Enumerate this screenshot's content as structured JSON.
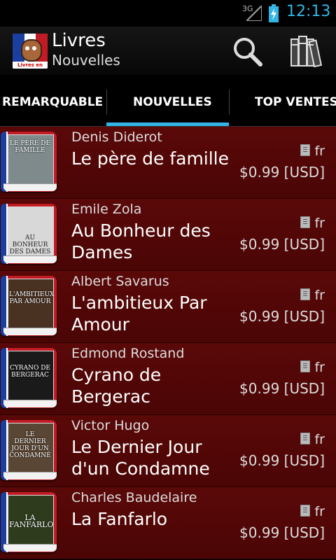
{
  "status": {
    "network": "3G",
    "time": "12:13"
  },
  "header": {
    "title": "Livres",
    "subtitle": "Nouvelles",
    "icon_text": "Livres en Français"
  },
  "tabs": [
    {
      "label": "REMARQUABLE",
      "selected": false
    },
    {
      "label": "NOUVELLES",
      "selected": true
    },
    {
      "label": "TOP VENTES",
      "selected": false
    }
  ],
  "books": [
    {
      "author": "Denis Diderot",
      "title": "Le père de famille",
      "cover_text": "LE PÈRE DE FAMILLE",
      "lang": "fr",
      "price": "$0.99 [USD]",
      "cover_color": "#7e8a8c"
    },
    {
      "author": "Emile Zola",
      "title": "Au Bonheur des Dames",
      "cover_text": "AU BONHEUR DES DAMES",
      "lang": "fr",
      "price": "$0.99 [USD]",
      "cover_color": "#d8d8d8"
    },
    {
      "author": "Albert Savarus",
      "title": "L'ambitieux Par Amour",
      "cover_text": "L'AMBITIEUX PAR AMOUR",
      "lang": "fr",
      "price": "$0.99 [USD]",
      "cover_color": "#4a3222"
    },
    {
      "author": "Edmond Rostand",
      "title": "Cyrano de Bergerac",
      "cover_text": "CYRANO DE BERGERAC",
      "lang": "fr",
      "price": "$0.99 [USD]",
      "cover_color": "#1a1a1a"
    },
    {
      "author": "Victor Hugo",
      "title": "Le Dernier Jour d'un Condamne",
      "cover_text": "LE DERNIER JOUR D'UN CONDAMNÉ",
      "lang": "fr",
      "price": "$0.99 [USD]",
      "cover_color": "#5a4634"
    },
    {
      "author": "Charles Baudelaire",
      "title": "La Fanfarlo",
      "cover_text": "LA FANFARLO",
      "lang": "fr",
      "price": "$0.99 [USD]",
      "cover_color": "#2e3b1c"
    }
  ],
  "colors": {
    "accent": "#33b5e5",
    "row_bg": "#5a0808"
  }
}
